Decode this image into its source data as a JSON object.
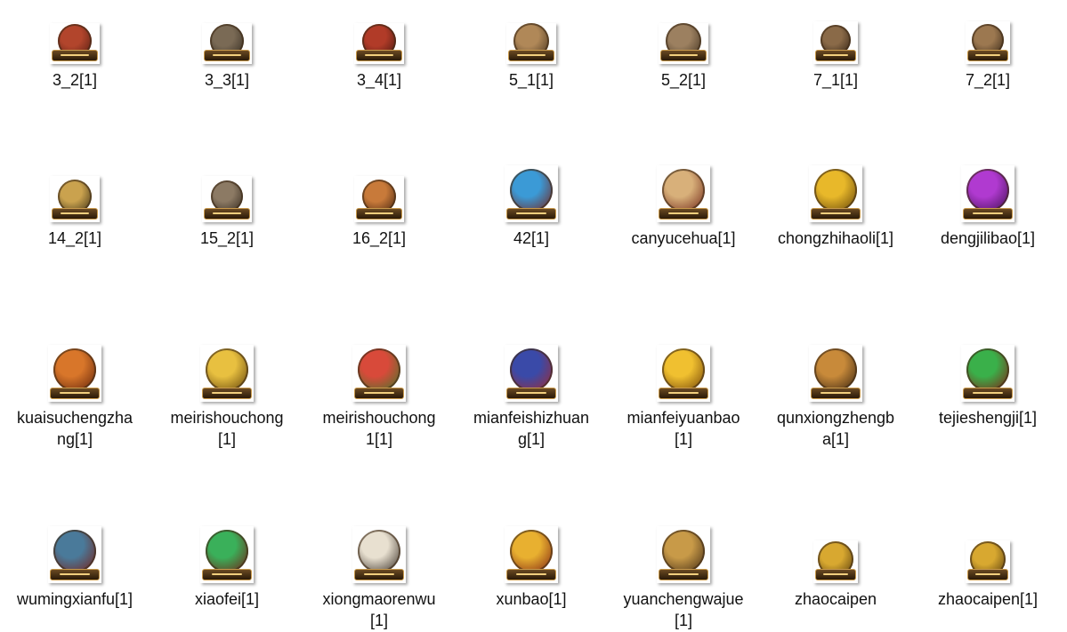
{
  "files": [
    {
      "name": "3_2[1]",
      "icon": "monkey-icon",
      "colors": [
        "#b2452c",
        "#4a1a10"
      ],
      "shape": "small",
      "disc": 38
    },
    {
      "name": "3_3[1]",
      "icon": "monkey-icon",
      "colors": [
        "#7a6a55",
        "#2e261c"
      ],
      "shape": "small",
      "disc": 38
    },
    {
      "name": "3_4[1]",
      "icon": "monkey-icon",
      "colors": [
        "#b13b28",
        "#3d150c"
      ],
      "shape": "small",
      "disc": 38
    },
    {
      "name": "5_1[1]",
      "icon": "recycle-anvil-icon",
      "colors": [
        "#b08858",
        "#3c2a18"
      ],
      "shape": "small",
      "disc": 40
    },
    {
      "name": "5_2[1]",
      "icon": "recycle-anvil-icon",
      "colors": [
        "#9c8060",
        "#3a2c1c"
      ],
      "shape": "small",
      "disc": 40
    },
    {
      "name": "7_1[1]",
      "icon": "auction-hammer-icon",
      "colors": [
        "#8a6a48",
        "#2a1c10"
      ],
      "shape": "mid",
      "disc": 34
    },
    {
      "name": "7_2[1]",
      "icon": "auction-hammer-icon",
      "colors": [
        "#9c7850",
        "#2e2012"
      ],
      "shape": "mid",
      "disc": 36
    },
    {
      "name": "14_2[1]",
      "icon": "rebirth-web-icon",
      "colors": [
        "#caa24e",
        "#2e2410"
      ],
      "shape": "tall",
      "disc": 38
    },
    {
      "name": "15_2[1]",
      "icon": "fist-icon",
      "colors": [
        "#8c7a64",
        "#2c2218"
      ],
      "shape": "tall",
      "disc": 36
    },
    {
      "name": "16_2[1]",
      "icon": "furnace-icon",
      "colors": [
        "#c87a3a",
        "#3a1c0a"
      ],
      "shape": "tall",
      "disc": 38
    },
    {
      "name": "42[1]",
      "icon": "anniversary-icon",
      "colors": [
        "#3b9ad6",
        "#7a1a10"
      ],
      "shape": "big",
      "disc": 48
    },
    {
      "name": "canyucehua[1]",
      "icon": "scroll-icon",
      "colors": [
        "#d8b07a",
        "#6a1e12"
      ],
      "shape": "big",
      "disc": 48
    },
    {
      "name": "chongzhihaoli[1]",
      "icon": "treasure-chest-icon",
      "colors": [
        "#e8b82a",
        "#5a3a06"
      ],
      "shape": "big",
      "disc": 48
    },
    {
      "name": "dengjilibao[1]",
      "icon": "gift-box-icon",
      "colors": [
        "#b03ad0",
        "#3a0c4a"
      ],
      "shape": "big",
      "disc": 48
    },
    {
      "name": "kuaisuchengzhang[1]",
      "icon": "muscle-arm-icon",
      "colors": [
        "#d8762a",
        "#5a1e08"
      ],
      "shape": "big",
      "disc": 48
    },
    {
      "name": "meirishouchong[1]",
      "icon": "gold-coins-icon",
      "colors": [
        "#e8c040",
        "#5a3a06"
      ],
      "shape": "big",
      "disc": 48
    },
    {
      "name": "meirishouchong1[1]",
      "icon": "gems-icon",
      "colors": [
        "#d84a3a",
        "#3a7a2a"
      ],
      "shape": "big",
      "disc": 48
    },
    {
      "name": "mianfeishizhuang[1]",
      "icon": "robe-icon",
      "colors": [
        "#3a4aa8",
        "#a8282a"
      ],
      "shape": "big",
      "disc": 48
    },
    {
      "name": "mianfeiyuanbao[1]",
      "icon": "gold-ingot-icon",
      "colors": [
        "#f0c030",
        "#6a3a04"
      ],
      "shape": "big",
      "disc": 48
    },
    {
      "name": "qunxiongzhengba[1]",
      "icon": "crossed-maces-icon",
      "colors": [
        "#c88a3a",
        "#2e1c0c"
      ],
      "shape": "big",
      "disc": 48
    },
    {
      "name": "tejieshengji[1]",
      "icon": "ring-upgrade-icon",
      "colors": [
        "#3ab04a",
        "#8a1410"
      ],
      "shape": "big",
      "disc": 48
    },
    {
      "name": "wumingxianfu[1]",
      "icon": "mansion-icon",
      "colors": [
        "#4a7a9a",
        "#7a1a10"
      ],
      "shape": "big",
      "disc": 48
    },
    {
      "name": "xiaofei[1]",
      "icon": "jade-ring-icon",
      "colors": [
        "#3ab05a",
        "#7a1410"
      ],
      "shape": "big",
      "disc": 48
    },
    {
      "name": "xiongmaorenwu[1]",
      "icon": "panda-icon",
      "colors": [
        "#e8e0d0",
        "#2a2018"
      ],
      "shape": "big",
      "disc": 48
    },
    {
      "name": "xunbao[1]",
      "icon": "treasure-bowl-icon",
      "colors": [
        "#e8b030",
        "#7a1a10"
      ],
      "shape": "big",
      "disc": 48
    },
    {
      "name": "yuanchengwajue[1]",
      "icon": "mining-pick-icon",
      "colors": [
        "#c89a48",
        "#3a2410"
      ],
      "shape": "big",
      "disc": 48
    },
    {
      "name": "zhaocaipen",
      "icon": "fortune-pot-icon",
      "colors": [
        "#d8a830",
        "#4a3008"
      ],
      "shape": "mid",
      "disc": 40
    },
    {
      "name": "zhaocaipen[1]",
      "icon": "fortune-pot-icon",
      "colors": [
        "#d8a830",
        "#4a3008"
      ],
      "shape": "mid",
      "disc": 40
    }
  ]
}
